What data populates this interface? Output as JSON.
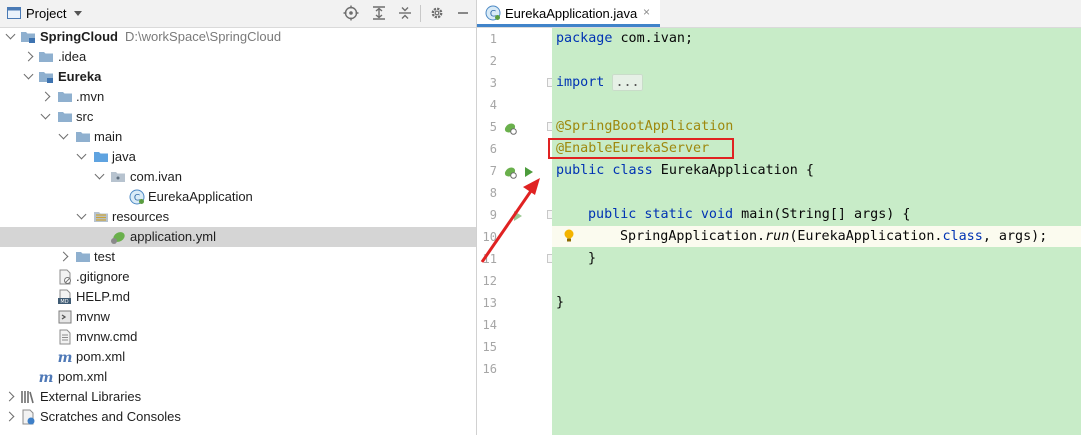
{
  "project_panel": {
    "title": "Project",
    "toolbar_icons": [
      "locate-icon",
      "expand-all-icon",
      "collapse-all-icon",
      "settings-icon",
      "hide-icon"
    ]
  },
  "tree": [
    {
      "label": "SpringCloud",
      "path": "D:\\workSpace\\SpringCloud",
      "bold": true,
      "icon": "module-folder-icon",
      "expanded": true
    },
    {
      "label": ".idea",
      "icon": "folder-icon",
      "expanded": false
    },
    {
      "label": "Eureka",
      "bold": true,
      "icon": "module-folder-icon",
      "expanded": true
    },
    {
      "label": ".mvn",
      "icon": "folder-icon",
      "expanded": false
    },
    {
      "label": "src",
      "icon": "folder-icon",
      "expanded": true
    },
    {
      "label": "main",
      "icon": "folder-icon",
      "expanded": true
    },
    {
      "label": "java",
      "icon": "source-folder-icon",
      "expanded": true
    },
    {
      "label": "com.ivan",
      "icon": "package-icon",
      "expanded": true
    },
    {
      "label": "EurekaApplication",
      "icon": "class-icon"
    },
    {
      "label": "resources",
      "icon": "resources-folder-icon",
      "expanded": true
    },
    {
      "label": "application.yml",
      "icon": "spring-config-icon",
      "selected": true
    },
    {
      "label": "test",
      "icon": "folder-icon",
      "expanded": false
    },
    {
      "label": ".gitignore",
      "icon": "gitignore-icon"
    },
    {
      "label": "HELP.md",
      "icon": "markdown-icon"
    },
    {
      "label": "mvnw",
      "icon": "shell-icon"
    },
    {
      "label": "mvnw.cmd",
      "icon": "text-file-icon"
    },
    {
      "label": "pom.xml",
      "icon": "maven-icon"
    },
    {
      "label": "pom.xml",
      "icon": "maven-icon"
    },
    {
      "label": "External Libraries",
      "icon": "libraries-icon",
      "expanded": false
    },
    {
      "label": "Scratches and Consoles",
      "icon": "scratches-icon",
      "expanded": false
    }
  ],
  "editor": {
    "tab": {
      "label": "EurekaApplication.java",
      "close": "×"
    },
    "line_numbers": [
      "1",
      "2",
      "3",
      "4",
      "5",
      "6",
      "7",
      "8",
      "9",
      "10",
      "11",
      "12",
      "13",
      "14",
      "15",
      "16"
    ],
    "code": {
      "l1_kw": "package",
      "l1_rest": " com.ivan;",
      "l3_kw": "import",
      "l3_fold": "...",
      "l7": "@SpringBootApplication",
      "l8": "@EnableEurekaServer",
      "l9_kw": "public class",
      "l9_rest": " EurekaApplication {",
      "l11_kw": "public static void",
      "l11_rest": " main(String[] args) {",
      "l12_a": "SpringApplication.",
      "l12_run": "run",
      "l12_b": "(EurekaApplication.",
      "l12_cls": "class",
      "l12_c": ", args);",
      "l13": "}",
      "l15": "}"
    }
  }
}
